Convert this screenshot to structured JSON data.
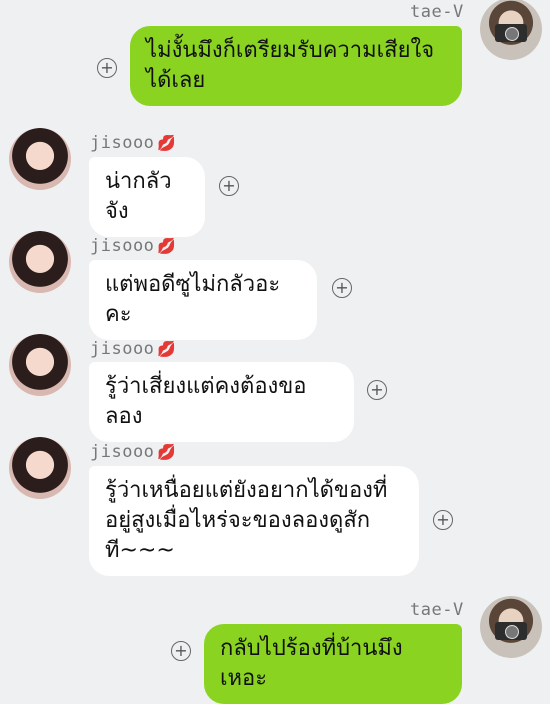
{
  "messages": [
    {
      "sender": "tae-V",
      "side": "out",
      "text": "ไม่งั้นมึงก็เตรียมรับความเสียใจได้เลย"
    },
    {
      "sender": "jisooo",
      "side": "in",
      "text": "น่ากลัวจัง"
    },
    {
      "sender": "jisooo",
      "side": "in",
      "text": "แต่พอดีซูไม่กลัวอะคะ"
    },
    {
      "sender": "jisooo",
      "side": "in",
      "text": "รู้ว่าเสี่ยงแต่คงต้องขอลอง"
    },
    {
      "sender": "jisooo",
      "side": "in",
      "text": "รู้ว่าเหนื่อยแต่ยังอยากได้ของที่อยู่สูงเมื่อไหร่จะของลองดูสักที~~~"
    },
    {
      "sender": "tae-V",
      "side": "out",
      "text": "กลับไปร้องที่บ้านมึงเหอะ"
    }
  ],
  "icons": {
    "reaction": "add-reaction-icon",
    "sender_mark": "kiss-lips-icon"
  },
  "colors": {
    "outgoing_bubble": "#8ad321",
    "incoming_bubble": "#ffffff",
    "background": "#eef0f2",
    "heart": "#e0202e"
  }
}
